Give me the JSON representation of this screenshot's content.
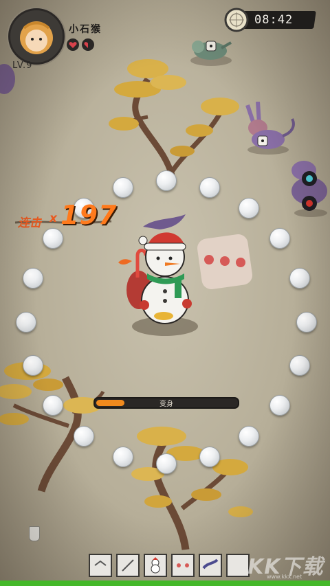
{
  "player": {
    "name": "小石猴",
    "level": "LV.9",
    "hearts": [
      "heart-full-icon",
      "heart-half-icon"
    ]
  },
  "timer": {
    "time": "08:42"
  },
  "combo": {
    "label": "连击",
    "times_sign": "x",
    "count": "197"
  },
  "transform_bar": {
    "label": "变身",
    "progress": 0.2
  },
  "skills": [
    "skill-empty",
    "skill-empty-2",
    "snowman-skill",
    "red-dots-skill",
    "purple-dragon-skill",
    "skill-empty-3"
  ],
  "watermark": {
    "main": "KK下载",
    "sub": "www.kkx.net"
  },
  "colors": {
    "accent": "#f08a1e",
    "combo": "#ff7a1c",
    "bottom_strip": "#44b829"
  }
}
